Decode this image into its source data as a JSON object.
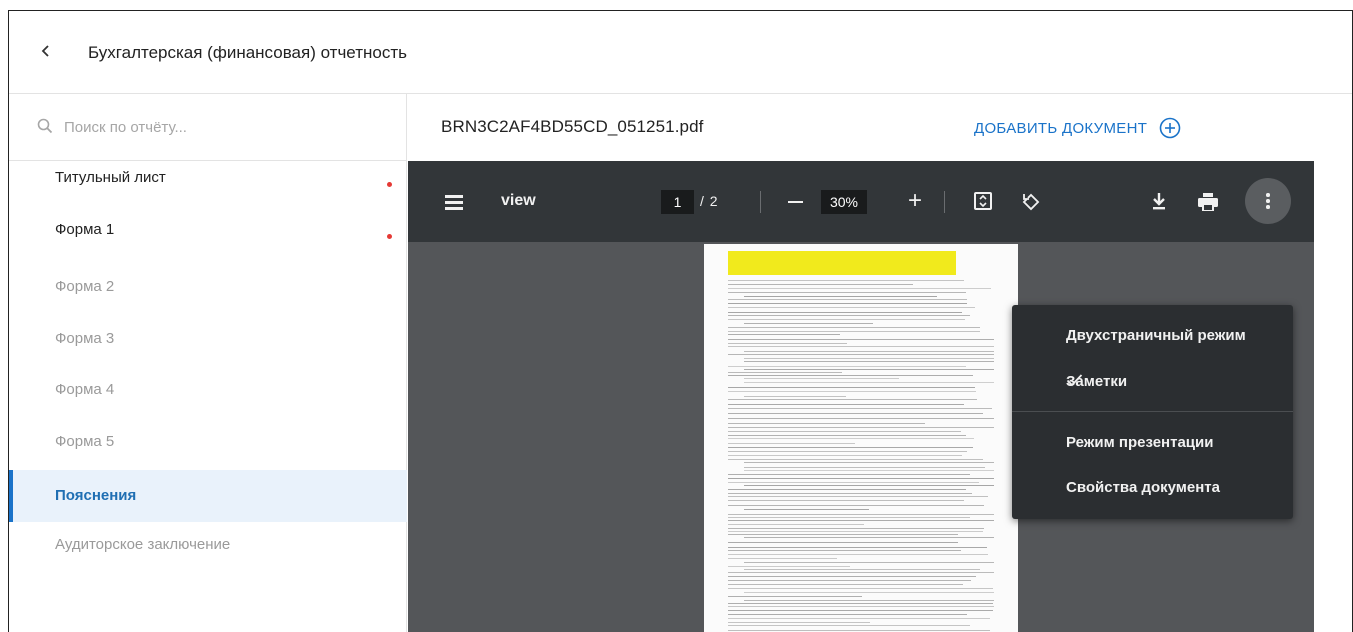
{
  "header": {
    "back_icon": "chevron-left-icon",
    "title": "Бухгалтерская (финансовая) отчетность"
  },
  "sidebar": {
    "search": {
      "placeholder": "Поиск по отчёту...",
      "value": ""
    },
    "items": [
      {
        "label": "Титульный лист",
        "state": "normal",
        "has_dot": true
      },
      {
        "label": "Форма 1",
        "state": "normal",
        "has_dot": true
      },
      {
        "label": "Форма 2",
        "state": "muted",
        "has_dot": false
      },
      {
        "label": "Форма 3",
        "state": "muted",
        "has_dot": false
      },
      {
        "label": "Форма 4",
        "state": "muted",
        "has_dot": false
      },
      {
        "label": "Форма 5",
        "state": "muted",
        "has_dot": false
      },
      {
        "label": "Пояснения",
        "state": "active",
        "has_dot": false
      },
      {
        "label": "Аудиторское заключение",
        "state": "muted",
        "has_dot": false
      }
    ],
    "dot_color": "#e53935",
    "active_color": "#1a73c9"
  },
  "document": {
    "filename": "BRN3C2AF4BD55CD_051251.pdf",
    "add_label": "ДОБАВИТЬ ДОКУМЕНТ"
  },
  "viewer": {
    "title": "view",
    "current_page": "1",
    "page_total": "/ 2",
    "zoom": "30%",
    "toolbar_color": "#323639",
    "background_color": "#545659"
  },
  "menu": {
    "items": [
      {
        "label": "Двухстраничный режим",
        "checked": false
      },
      {
        "label": "Заметки",
        "checked": true
      },
      {
        "label": "Режим презентации",
        "checked": false
      },
      {
        "label": "Свойства документа",
        "checked": false
      }
    ]
  }
}
